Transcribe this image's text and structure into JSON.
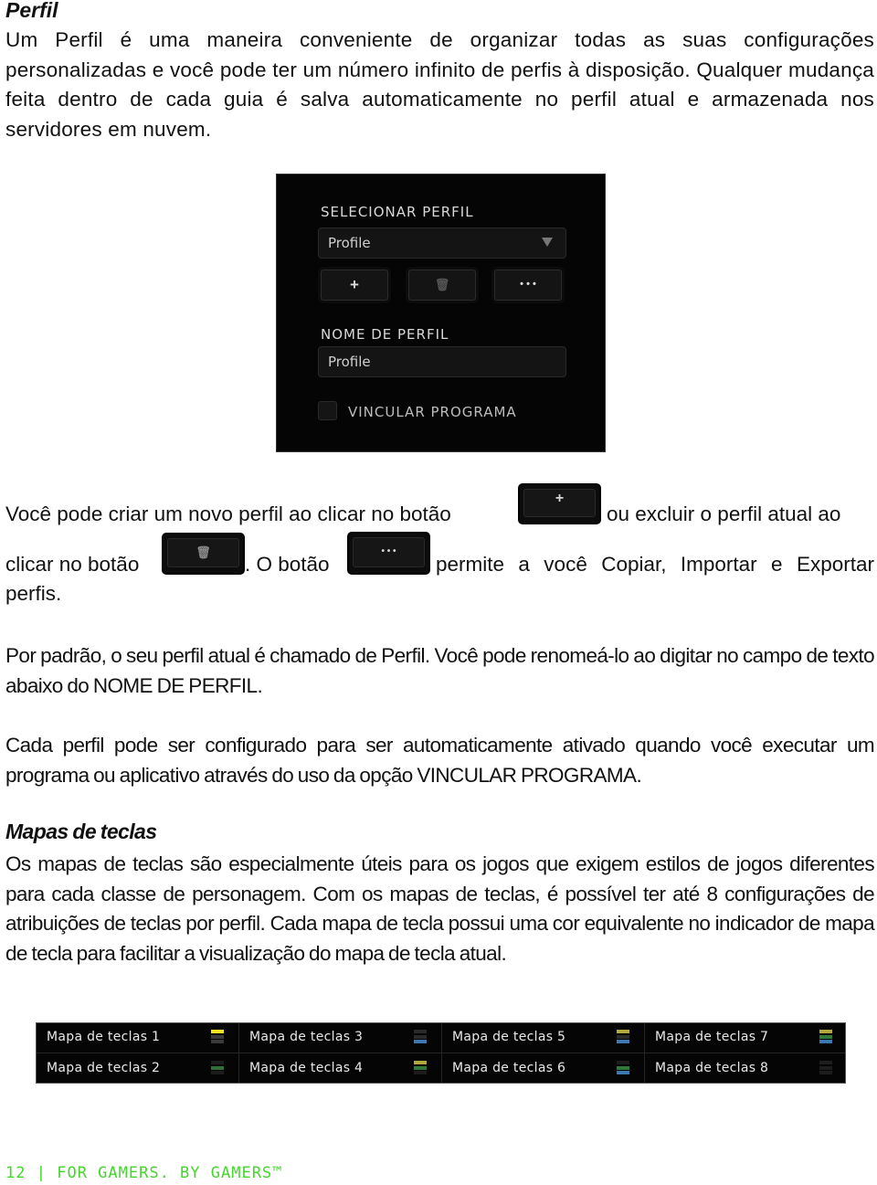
{
  "section_profile": {
    "heading": "Perfil",
    "intro": "Um Perfil é uma maneira conveniente de organizar todas as suas configurações personalizadas e você pode ter um número infinito de perfis à disposição. Qualquer mudança feita dentro de cada guia é salva automaticamente no perfil atual e armazenada nos servidores em nuvem."
  },
  "profile_panel": {
    "select_label": "SELECIONAR PERFIL",
    "selected_profile": "Profile",
    "buttons": {
      "add": "+",
      "delete": "🗑",
      "more": "• • •"
    },
    "name_label": "NOME DE PERFIL",
    "name_value": "Profile",
    "link_program_label": "VINCULAR PROGRAMA",
    "link_program_checked": false
  },
  "buttons_paragraph": {
    "part1": "Você pode criar um novo perfil ao clicar no botão",
    "part2": "ou excluir o perfil atual ao",
    "part3": "clicar no botão",
    "part4": ". O botão",
    "part5": "permite a você Copiar, Importar e Exportar",
    "part6": "perfis.",
    "add_glyph": "+",
    "trash_glyph": "🗑",
    "more_glyph": "• • •"
  },
  "paragraph_default": "Por padrão, o seu perfil atual é chamado de Perfil. Você pode renomeá-lo ao digitar no campo de texto abaixo do NOME DE PERFIL.",
  "paragraph_link": "Cada perfil pode ser configurado para ser automaticamente ativado quando você executar um programa ou aplicativo através do uso da opção VINCULAR PROGRAMA.",
  "section_keymaps": {
    "heading": "Mapas de teclas",
    "text": "Os mapas de teclas são especialmente úteis para os jogos que exigem estilos de jogos diferentes para cada classe de personagem. Com os mapas de teclas, é possível ter até 8 configurações de atribuições de teclas por perfil. Cada mapa de tecla possui uma cor equivalente no indicador de mapa de tecla para facilitar a visualização do mapa de tecla atual."
  },
  "keymaps": [
    {
      "label": "Mapa de teclas 1",
      "bars": [
        "#f2e320",
        "#3a3a3a",
        "#3a3a3a"
      ]
    },
    {
      "label": "Mapa de teclas 2",
      "bars": [
        "#1c1c1c",
        "#2f6e37",
        "#1c1c1c"
      ]
    },
    {
      "label": "Mapa de teclas 3",
      "bars": [
        "#2a2a2a",
        "#2a2a2a",
        "#3d79b0"
      ]
    },
    {
      "label": "Mapa de teclas 4",
      "bars": [
        "#b2a93c",
        "#2f7a3b",
        "#1c1c1c"
      ]
    },
    {
      "label": "Mapa de teclas 5",
      "bars": [
        "#b2a93c",
        "#2a2a2a",
        "#3d79b0"
      ]
    },
    {
      "label": "Mapa de teclas 6",
      "bars": [
        "#1c1c1c",
        "#2f7a3b",
        "#3d79b0"
      ]
    },
    {
      "label": "Mapa de teclas 7",
      "bars": [
        "#b2a93c",
        "#2f7a3b",
        "#3d79b0"
      ]
    },
    {
      "label": "Mapa de teclas 8",
      "bars": [
        "#1e1e1e",
        "#1e1e1e",
        "#1e1e1e"
      ]
    }
  ],
  "footer": {
    "page_number": "12",
    "separator": "|",
    "tagline": "FOR GAMERS. BY GAMERS™",
    "color": "#44d62c"
  }
}
